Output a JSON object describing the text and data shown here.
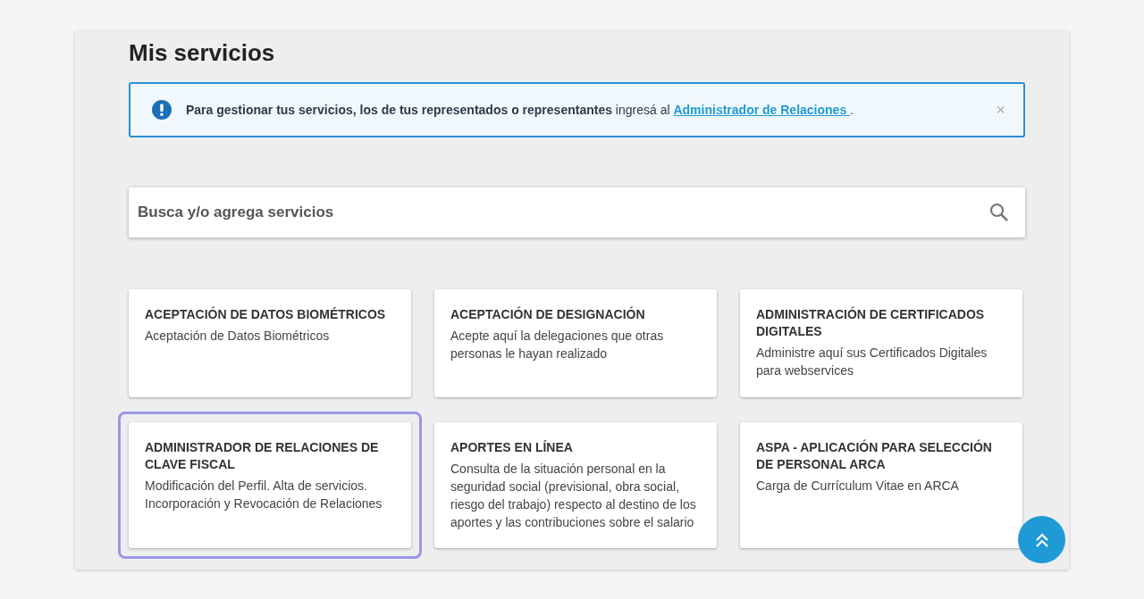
{
  "title": "Mis servicios",
  "alert": {
    "message": "**Para gestionar tus servicios, los de tus representados o representantes** ingresá al",
    "link": "Administrador de Relaciones ",
    "suffix": ".",
    "close": "×"
  },
  "search": {
    "placeholder": "Busca y/o agrega servicios"
  },
  "services": [
    {
      "title": "ACEPTACIÓN DE DATOS BIOMÉTRICOS",
      "description": "Aceptación de Datos Biométricos",
      "selected": false
    },
    {
      "title": "ACEPTACIÓN DE DESIGNACIÓN",
      "description": "Acepte aquí la delegaciones que otras personas le hayan realizado",
      "selected": false
    },
    {
      "title": "ADMINISTRACIÓN DE CERTIFICADOS DIGITALES",
      "description": "Administre aquí sus Certificados Digitales para webservices",
      "selected": false
    },
    {
      "title": "ADMINISTRADOR DE RELACIONES DE CLAVE FISCAL",
      "description": "Modificación del Perfil. Alta de servicios. Incorporación y Revocación de Relaciones",
      "selected": true
    },
    {
      "title": "APORTES EN LÍNEA",
      "description": "Consulta de la situación personal en la seguridad social (previsional, obra social, riesgo del trabajo) respecto al destino de los aportes y las contribuciones sobre el salario",
      "selected": false
    },
    {
      "title": "ASPA - APLICACIÓN PARA SELECCIÓN DE PERSONAL ARCA",
      "description": "Carga de Currículum Vitae en ARCA",
      "selected": false
    }
  ]
}
